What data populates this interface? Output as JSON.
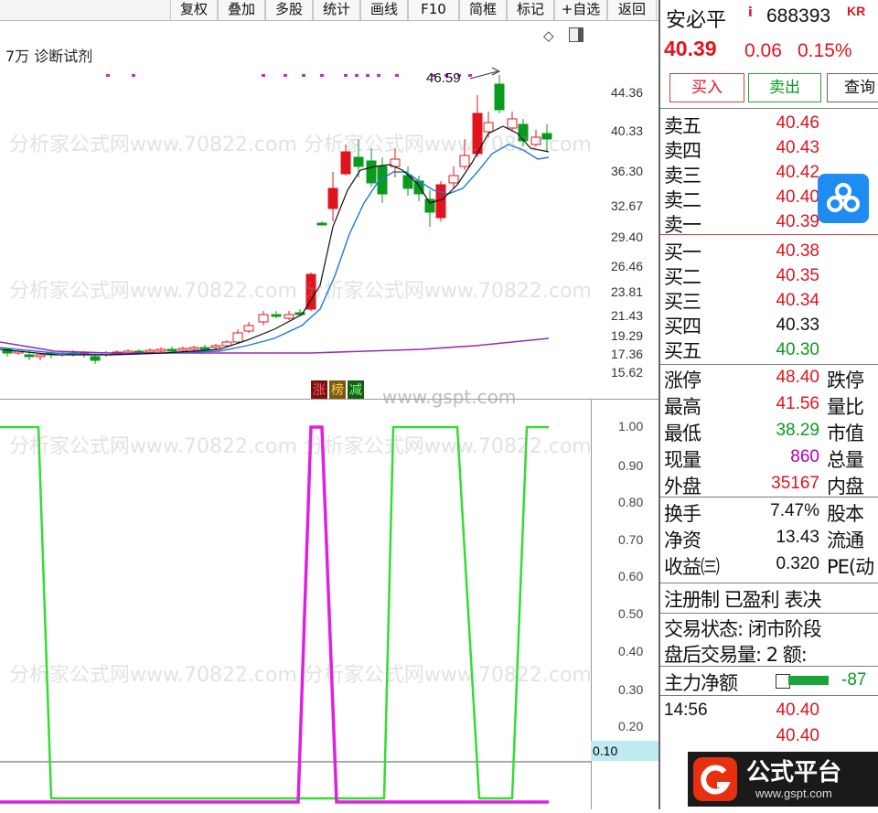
{
  "toolbar": {
    "buttons": [
      "复权",
      "叠加",
      "多股",
      "统计",
      "画线",
      "F10",
      "简框",
      "标记",
      "+自选",
      "返回"
    ]
  },
  "main_chart": {
    "indicator_title": "7万 诊断试剂",
    "peak_label": "46.59",
    "y_ticks": [
      "44.36",
      "40.33",
      "36.30",
      "32.67",
      "29.40",
      "26.46",
      "23.81",
      "21.43",
      "19.29",
      "17.36",
      "15.62"
    ],
    "tags": [
      "涨",
      "榜",
      "减"
    ],
    "watermark": "www.gspt.com"
  },
  "sub_chart": {
    "y_ticks": [
      "1.00",
      "0.90",
      "0.80",
      "0.70",
      "0.60",
      "0.50",
      "0.40",
      "0.30",
      "0.20"
    ],
    "current_value": "0.10"
  },
  "stock": {
    "name": "安必平",
    "info_icon": "i",
    "code": "688393",
    "suffix": "KR",
    "price": "40.39",
    "change": "0.06",
    "change_pct": "0.15%",
    "buy_btn": "买入",
    "sell_btn": "卖出",
    "query_btn": "查询"
  },
  "order_book": {
    "sells": [
      {
        "label": "卖五",
        "price": "40.46",
        "color": "red"
      },
      {
        "label": "卖四",
        "price": "40.43",
        "color": "red"
      },
      {
        "label": "卖三",
        "price": "40.42",
        "color": "red"
      },
      {
        "label": "卖二",
        "price": "40.40",
        "color": "red"
      },
      {
        "label": "卖一",
        "price": "40.39",
        "color": "red"
      }
    ],
    "buys": [
      {
        "label": "买一",
        "price": "40.38",
        "color": "red"
      },
      {
        "label": "买二",
        "price": "40.35",
        "color": "red"
      },
      {
        "label": "买三",
        "price": "40.34",
        "color": "red"
      },
      {
        "label": "买四",
        "price": "40.33",
        "color": "blk"
      },
      {
        "label": "买五",
        "price": "40.30",
        "color": "green"
      }
    ]
  },
  "quote": [
    {
      "label": "涨停",
      "value": "48.40",
      "color": "red",
      "label2": "跌停"
    },
    {
      "label": "最高",
      "value": "41.56",
      "color": "red",
      "label2": "量比"
    },
    {
      "label": "最低",
      "value": "38.29",
      "color": "green",
      "label2": "市值"
    },
    {
      "label": "现量",
      "value": "860",
      "color": "purple",
      "label2": "总量"
    },
    {
      "label": "外盘",
      "value": "35167",
      "color": "red",
      "label2": "内盘"
    }
  ],
  "finance": [
    {
      "label": "换手",
      "value": "7.47%",
      "label2": "股本"
    },
    {
      "label": "净资",
      "value": "13.43",
      "label2": "流通"
    },
    {
      "label": "收益㈢",
      "value": "0.320",
      "label2": "PE(动"
    }
  ],
  "status": {
    "line1": "注册制 已盈利 表决",
    "line2": "交易状态: 闭市阶段",
    "line3": "盘后交易量: 2  额:",
    "main_flow_label": "主力净额",
    "main_flow_value": "-87"
  },
  "ticks": [
    {
      "time": "14:56",
      "price": "40.40"
    },
    {
      "time": "",
      "price": "40.40"
    }
  ],
  "logo": {
    "text": "公式平台",
    "url": "www.gspt.com"
  },
  "colors": {
    "up": "#e0141e",
    "down": "#0a9a1e",
    "ma5": "#111111",
    "ma10": "#1e78d8",
    "ma60": "#9a2ab8",
    "sig_green": "#33dd33",
    "sig_magenta": "#e020e0"
  }
}
